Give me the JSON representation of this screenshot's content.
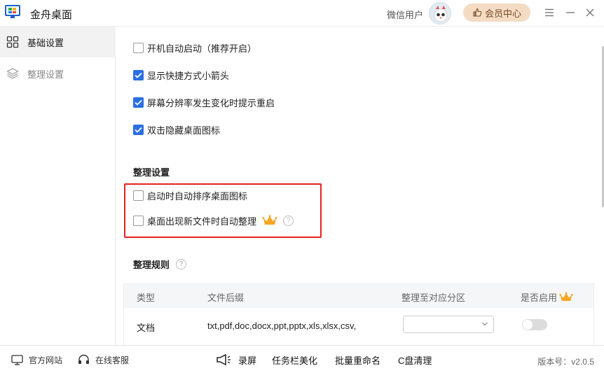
{
  "titlebar": {
    "app_title": "金舟桌面",
    "user_name": "微信用户",
    "vip_label": "会员中心",
    "menu_icon": "hamburger-icon",
    "minimize_icon": "minimize-icon",
    "close_icon": "close-icon"
  },
  "sidebar": {
    "items": [
      {
        "label": "基础设置",
        "icon": "grid-icon",
        "active": true
      },
      {
        "label": "整理设置",
        "icon": "layers-icon",
        "active": false
      }
    ]
  },
  "main": {
    "options": [
      {
        "label": "开机自动启动（推荐开启）",
        "checked": false
      },
      {
        "label": "显示快捷方式小箭头",
        "checked": true
      },
      {
        "label": "屏幕分辨率发生变化时提示重启",
        "checked": true
      },
      {
        "label": "双击隐藏桌面图标",
        "checked": true
      }
    ],
    "organize_title": "整理设置",
    "organize_options": [
      {
        "label": "启动时自动排序桌面图标",
        "checked": false
      },
      {
        "label": "桌面出现新文件时自动整理",
        "checked": false,
        "vip": true,
        "help": true
      }
    ],
    "rules_title": "整理规则",
    "rules_table": {
      "headers": [
        "类型",
        "文件后缀",
        "整理至对应分区",
        "是否启用"
      ],
      "rows": [
        {
          "type": "文档",
          "suffix": "txt,pdf,doc,docx,ppt,pptx,xls,xlsx,csv,",
          "zone": "",
          "enabled": false
        }
      ]
    }
  },
  "footer": {
    "website": "官方网站",
    "support": "在线客服",
    "tools": [
      "录屏",
      "任务栏美化",
      "批量重命名",
      "C盘清理"
    ],
    "version": "版本号：v2.0.5"
  },
  "colors": {
    "accent": "#2b6fe3",
    "highlight": "#e62020",
    "vip_bg": "#f4dcc4",
    "crown": "#f5a623"
  }
}
